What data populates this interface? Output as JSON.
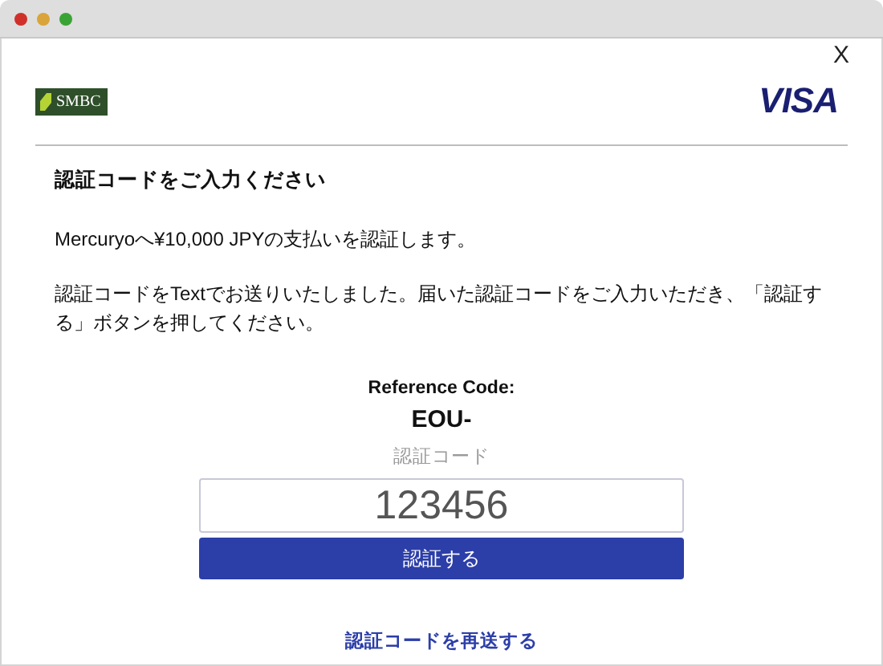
{
  "window": {
    "controls": [
      {
        "color": "#d0302a"
      },
      {
        "color": "#d9a43a"
      },
      {
        "color": "#3aa335"
      }
    ]
  },
  "dialog": {
    "close": "X",
    "bank_logo": "SMBC",
    "card_logo": "VISA"
  },
  "heading": "認証コードをご入力ください",
  "paragraphs": [
    "Mercuryoへ¥10,000 JPYの支払いを認証します。",
    "認証コードをTextでお送りいたしました。届いた認証コードをご入力いただき、「認証する」ボタンを押してください。"
  ],
  "reference": {
    "label": "Reference Code:",
    "value": "EOU-"
  },
  "code_field": {
    "label": "認証コード",
    "value": "123456"
  },
  "submit_button": "認証する",
  "resend_link": "認証コードを再送する"
}
